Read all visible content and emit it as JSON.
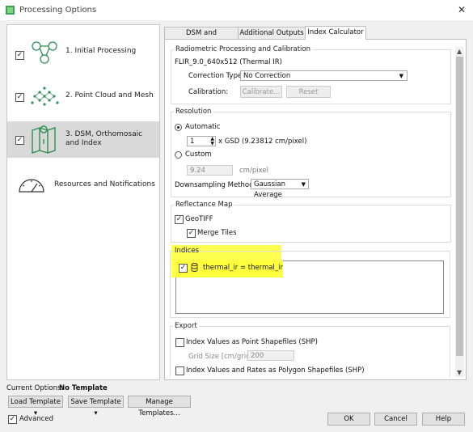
{
  "window": {
    "title": "Processing Options",
    "close_glyph": "✕"
  },
  "steps": [
    {
      "label": "1. Initial Processing",
      "checked": true,
      "icon": "initial-processing-icon"
    },
    {
      "label": "2. Point Cloud and Mesh",
      "checked": true,
      "icon": "point-cloud-icon"
    },
    {
      "label": "3. DSM, Orthomosaic and Index",
      "checked": true,
      "icon": "map-icon",
      "selected": true
    },
    {
      "label": "Resources and Notifications",
      "icon": "gauge-icon"
    }
  ],
  "tabs": [
    {
      "label": "DSM and Orthomosaic"
    },
    {
      "label": "Additional Outputs"
    },
    {
      "label": "Index Calculator",
      "active": true
    }
  ],
  "radiometric": {
    "group_label": "Radiometric Processing and Calibration",
    "camera": "FLIR_9.0_640x512 (Thermal IR)",
    "correction_label": "Correction Type:",
    "correction_value": "No Correction",
    "calibration_label": "Calibration:",
    "calibrate_btn": "Calibrate...",
    "reset_btn": "Reset"
  },
  "resolution": {
    "group_label": "Resolution",
    "automatic": "Automatic",
    "gsd_value": "1",
    "gsd_text": "x GSD (9.23812 cm/pixel)",
    "custom": "Custom",
    "custom_value": "9.24",
    "custom_unit": "cm/pixel",
    "downsampling_label": "Downsampling Method:",
    "downsampling_value": "Gaussian Average"
  },
  "reflectance": {
    "group_label": "Reflectance Map",
    "geotiff": "GeoTIFF",
    "merge": "Merge Tiles"
  },
  "indices": {
    "group_label": "Indices",
    "item": "thermal_ir = thermal_ir"
  },
  "export": {
    "group_label": "Export",
    "point_shp": "Index Values as Point Shapefiles (SHP)",
    "grid_label": "Grid Size [cm/grid]:",
    "grid_value": "200",
    "polygon_shp": "Index Values and Rates as Polygon Shapefiles (SHP)"
  },
  "footer": {
    "current_label": "Current Options:",
    "current_value": "No Template",
    "load": "Load Template",
    "save": "Save Template",
    "manage": "Manage Templates...",
    "advanced": "Advanced",
    "ok": "OK",
    "cancel": "Cancel",
    "help": "Help"
  },
  "colors": {
    "highlight": "#ffff3c",
    "icon_green": "#2f8f55"
  }
}
